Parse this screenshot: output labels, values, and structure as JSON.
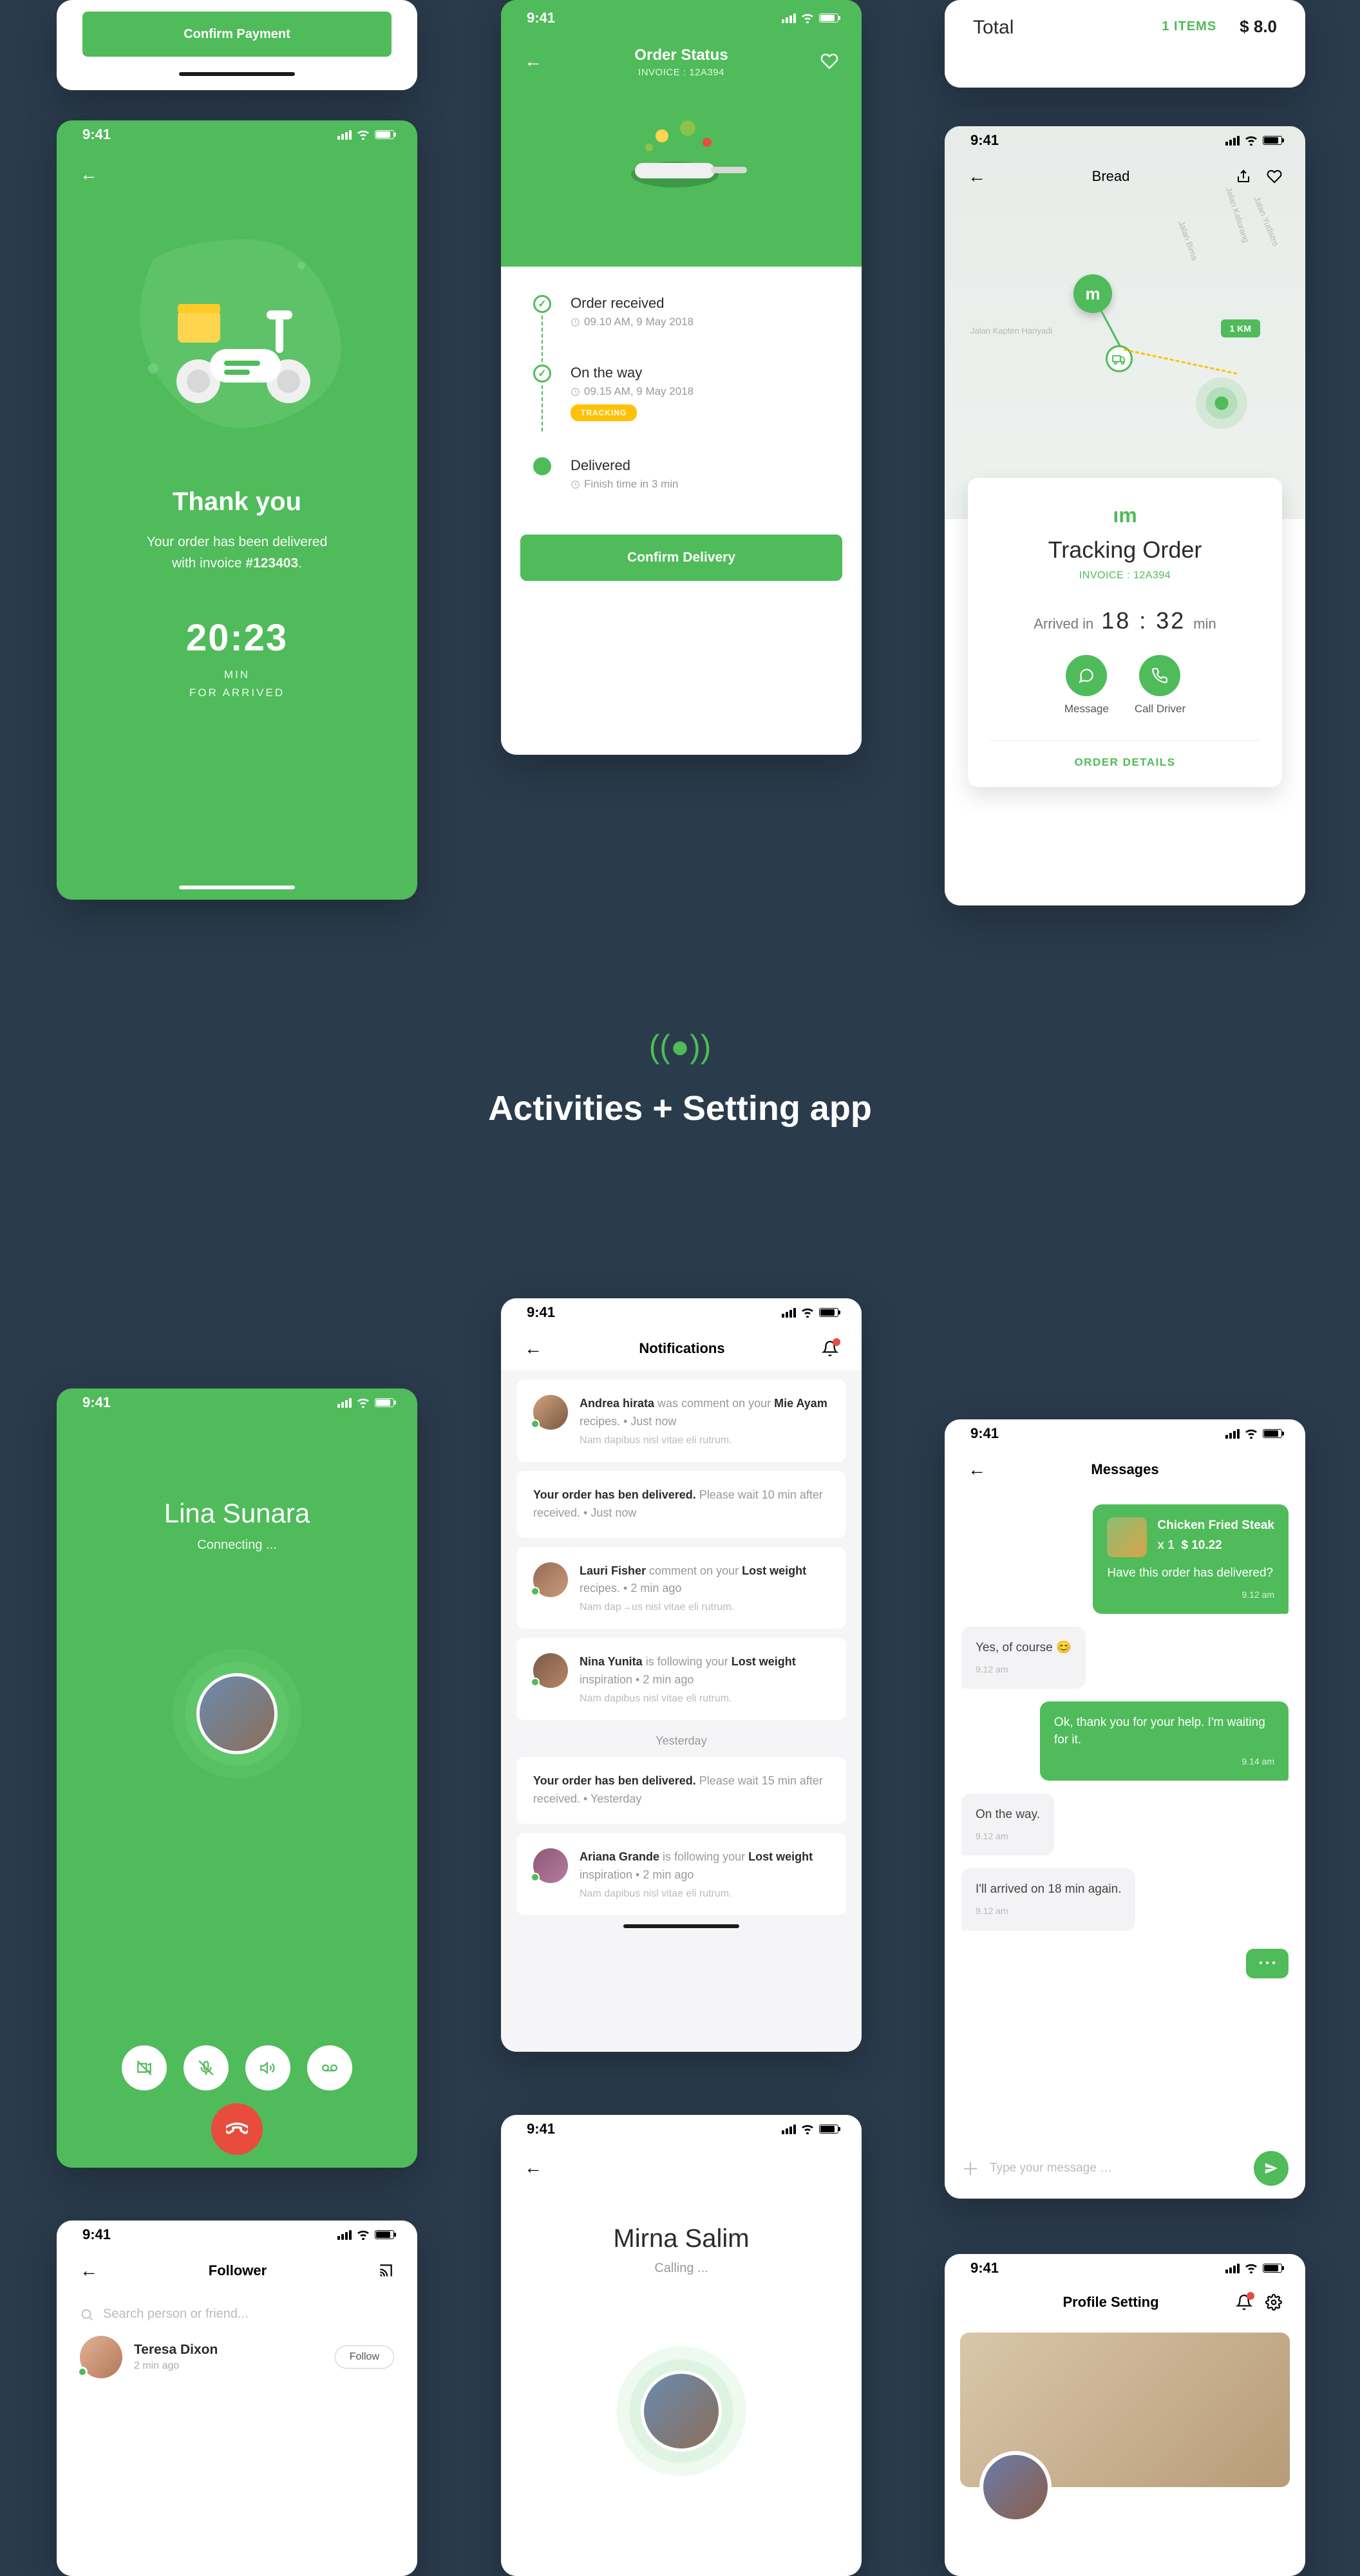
{
  "status_time": "9:41",
  "confirm_payment": {
    "button": "Confirm Payment"
  },
  "total_strip": {
    "label": "Total",
    "items": "1 ITEMS",
    "price": "$ 8.0"
  },
  "order_status": {
    "title": "Order Status",
    "invoice_label": "INVOICE : 12A394",
    "steps": [
      {
        "title": "Order received",
        "sub": "09.10 AM, 9 May 2018"
      },
      {
        "title": "On the way",
        "sub": "09.15 AM, 9 May 2018",
        "badge": "TRACKING"
      },
      {
        "title": "Delivered",
        "sub": "Finish time in 3 min"
      }
    ],
    "confirm_button": "Confirm Delivery"
  },
  "thank_you": {
    "title": "Thank you",
    "message_line1": "Your order has  been delivered",
    "message_line2_pre": "with invoice ",
    "invoice": "#123403",
    "time": "20:23",
    "min_label": "MIN",
    "for_arrived": "FOR ARRIVED"
  },
  "tracking": {
    "top_title": "Bread",
    "km_badge": "1 KM",
    "roads": [
      "Jalan Kaliurang",
      "Jalan Bima",
      "Jalan Yudistro",
      "Jalan Kapten Hariyadi"
    ],
    "card_title": "Tracking Order",
    "invoice": "INVOICE : 12A394",
    "arrived_label": "Arrived in",
    "arrived_time": "18 : 32",
    "arrived_unit": "min",
    "action_message": "Message",
    "action_call": "Call Driver",
    "footer": "ORDER DETAILS"
  },
  "section_title": "Activities + Setting app",
  "call_lina": {
    "name": "Lina Sunara",
    "status": "Connecting ..."
  },
  "notifications": {
    "title": "Notifications",
    "items": [
      {
        "name": "Andrea hirata",
        "action": " was comment on your ",
        "target": "Mie Ayam",
        "tail": " recipes.  •  Just now",
        "sub": "Nam dapibus nisl vitae eli rutrum."
      },
      {
        "plain_pre": "Your order has ben delivered.",
        "plain_post": " Please wait 10 min after received.  •  Just now"
      },
      {
        "name": "Lauri Fisher",
        "action": " comment on your ",
        "target": "Lost weight",
        "tail": " recipes.  •  2 min ago",
        "sub": "Nam dap→us nisl vitae eli rutrum."
      },
      {
        "name": "Nina Yunita",
        "action": " is following your ",
        "target": "Lost weight",
        "tail": " inspiration • 2 min ago",
        "sub": "Nam dapibus nisl vitae eli rutrum."
      }
    ],
    "divider": "Yesterday",
    "items2": [
      {
        "plain_pre": "Your order has ben delivered.",
        "plain_post": " Please wait 15 min after received.  •  Yesterday"
      },
      {
        "name": "Ariana Grande",
        "action": " is following your ",
        "target": "Lost weight",
        "tail": " inspiration • 2 min ago",
        "sub": "Nam dapibus nisl vitae eli rutrum."
      }
    ]
  },
  "messages": {
    "title": "Messages",
    "order": {
      "name": "Chicken Fried Steak",
      "qty": "x 1",
      "price": "$ 10.22"
    },
    "bubbles": [
      {
        "side": "me",
        "rich": true,
        "text": "Have this order has delivered?",
        "time": "9.12 am"
      },
      {
        "side": "them",
        "text": "Yes, of course 😊",
        "time": "9.12 am"
      },
      {
        "side": "me",
        "text": "Ok, thank you for your help. I'm waiting for it.",
        "time": "9.14 am"
      },
      {
        "side": "them",
        "text": "On the way.",
        "time": "9.12 am"
      },
      {
        "side": "them",
        "text": "I'll arrived on 18 min again.",
        "time": "9.12 am"
      }
    ],
    "input_placeholder": "Type your message …"
  },
  "follower": {
    "title": "Follower",
    "search_placeholder": "Search person or friend...",
    "person": {
      "name": "Teresa Dixon",
      "time": "2 min ago",
      "button": "Follow"
    }
  },
  "call_mirna": {
    "name": "Mirna Salim",
    "status": "Calling ..."
  },
  "profile": {
    "title": "Profile Setting"
  }
}
